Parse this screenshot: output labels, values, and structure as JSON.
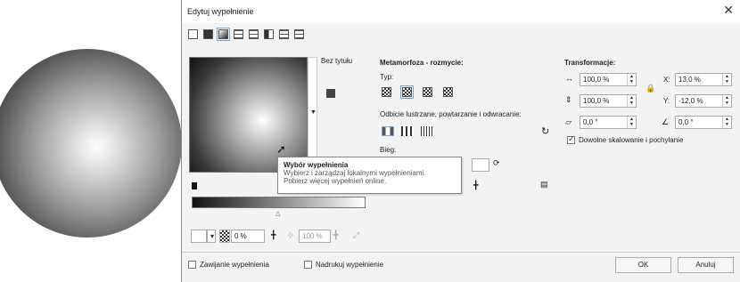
{
  "dialog": {
    "title": "Edytuj wypełnienie",
    "close_glyph": "✕",
    "fill_type_icons": [
      "no-fill-icon",
      "uniform-fill-icon",
      "fountain-fill-icon",
      "vector-pattern-icon",
      "bitmap-pattern-icon",
      "two-color-pattern-icon",
      "texture-fill-icon",
      "postscript-fill-icon"
    ],
    "selected_fill_type": "fountain-fill-icon"
  },
  "preview": {
    "name_label": "Bez tytułu"
  },
  "blend": {
    "heading": "Metamorfoza - rozmycie:",
    "type_label": "Typ:",
    "mirror_label": "Odbicie lustrzane, powtarzanie i odwracanie:",
    "speed_label": "Bieg:"
  },
  "transform": {
    "heading": "Transformacje:",
    "width_value": "100,0 %",
    "height_value": "100,0 %",
    "x_label": "X:",
    "x_value": "13,0 %",
    "y_label": "Y:",
    "y_value": "-12,0 %",
    "skew_value": "0,0 °",
    "rotate_value": "0,0 °",
    "free_scale_label": "Dowolne skalowanie i pochylanie"
  },
  "tooltip": {
    "title": "Wybór wypełnienia",
    "line1": "Wybierz i zarządzaj lokalnymi wypełnieniami.",
    "line2": "Pobierz więcej wypełnień online."
  },
  "node_controls": {
    "transparency_value": "0 %",
    "position_value": "100 %"
  },
  "footer": {
    "wrap_label": "Zawijanie wypełnienia",
    "overprint_label": "Nadrukuj wypełnienie",
    "ok_label": "OK",
    "cancel_label": "Anuluj"
  },
  "colors": {
    "accent": "#7aa7d6",
    "dialog_bg": "#f3f3f3"
  }
}
